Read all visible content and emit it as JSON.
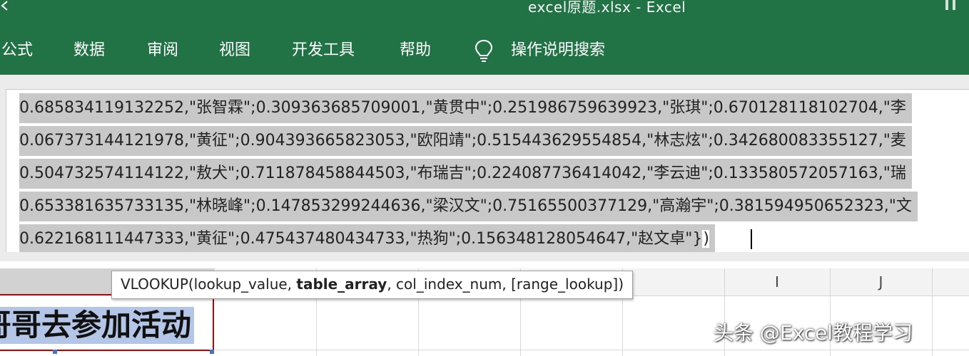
{
  "window": {
    "title": "excel原题.xlsx  -  Excel",
    "icons": {
      "back": "back-arrow-icon",
      "restore": "restore-window-icon",
      "tell_me": "lightbulb-icon"
    }
  },
  "ribbon": {
    "tabs": [
      "公式",
      "数据",
      "审阅",
      "视图",
      "开发工具",
      "帮助"
    ],
    "tell_me_label": "操作说明搜索"
  },
  "formula_bar": {
    "lines": [
      "0.685834119132252,\"张智霖\";0.309363685709001,\"黄贯中\";0.251986759639923,\"张琪\";0.670128118102704,\"李",
      "0.067373144121978,\"黄征\";0.904393665823053,\"欧阳靖\";0.515443629554854,\"林志炫\";0.342680083355127,\"麦",
      "0.504732574114122,\"敖犬\";0.711878458844503,\"布瑞吉\";0.224087736414042,\"李云迪\";0.133580572057163,\"瑞",
      "0.653381635733135,\"林晓峰\";0.147853299244636,\"梁汉文\";0.75165500377129,\"高瀚宇\";0.381594950652323,\"文",
      "0.622168111447333,\"黄征\";0.475437480434733,\"热狗\";0.156348128054647,\"赵文卓\"}"
    ],
    "trailing": ")"
  },
  "tooltip": {
    "prefix": "VLOOKUP(lookup_value, ",
    "bold": "table_array",
    "suffix": ", col_index_num, [range_lookup])"
  },
  "grid": {
    "column_headers": [
      "I",
      "J"
    ],
    "cell_text": "哥哥去参加活动"
  },
  "watermark": "头条 @Excel教程学习",
  "colors": {
    "ribbon": "#217346",
    "selection": "#c8c8c8",
    "cell_highlight": "#b4c6e7",
    "active_border": "#c00000"
  }
}
